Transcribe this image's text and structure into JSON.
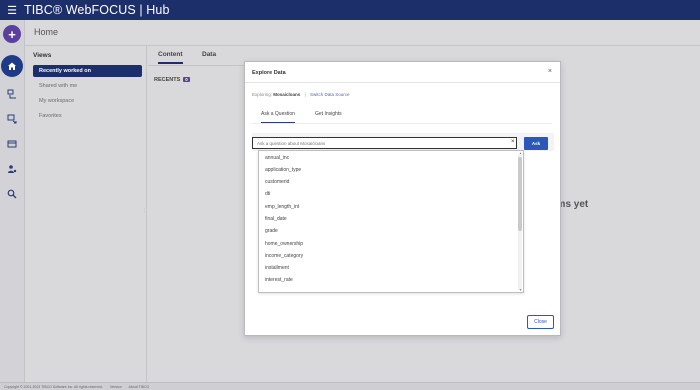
{
  "app": {
    "brand": "TIBC® WebFOCUS | Hub"
  },
  "header": {
    "title": "Home"
  },
  "sidebar": {
    "title": "Views",
    "items": [
      {
        "label": "Recently worked on",
        "active": true
      },
      {
        "label": "Shared with me"
      },
      {
        "label": "My workspace"
      },
      {
        "label": "Favorites"
      }
    ]
  },
  "content": {
    "tabs": [
      {
        "label": "Content",
        "active": true
      },
      {
        "label": "Data"
      }
    ],
    "recents_label": "RECENTS",
    "recents_count": "0",
    "empty_message": "n items yet"
  },
  "modal": {
    "title": "Explore Data",
    "close_glyph": "×",
    "exploring_label": "Exploring:",
    "exploring_source": "Mosaicloans",
    "switch_label": "Switch Data Source",
    "tabs": [
      {
        "label": "Ask a Question",
        "active": true
      },
      {
        "label": "Get Insights"
      }
    ],
    "search": {
      "value": "Ask a question about Mosaicloans",
      "clear_glyph": "×"
    },
    "ask_button": "Ask",
    "options": [
      "annual_inc",
      "application_type",
      "customerid",
      "dti",
      "emp_length_int",
      "final_date",
      "grade",
      "home_ownership",
      "income_category",
      "installment",
      "interest_rate"
    ],
    "close_button": "Close"
  },
  "footer": {
    "copyright": "Copyright © 2001-2023 TIBCO Software Inc. All rights reserved.",
    "version": "Version",
    "about": "About TIBCO"
  }
}
